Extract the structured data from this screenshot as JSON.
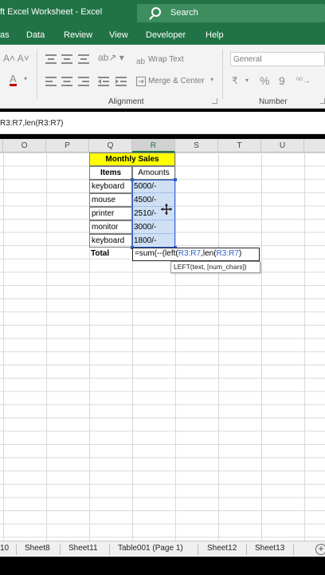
{
  "titlebar": {
    "title": "ft Excel Worksheet  -  Excel",
    "search_placeholder": "Search"
  },
  "menu": [
    "as",
    "Data",
    "Review",
    "View",
    "Developer",
    "Help"
  ],
  "ribbon": {
    "wrap_text": "Wrap Text",
    "merge_center": "Merge & Center",
    "number_format": "General",
    "alignment_label": "Alignment",
    "number_label": "Number",
    "font_size_glyphs": "A˄ A˅",
    "font_color_glyph": "A",
    "percent": "%",
    "comma": "9",
    "currency": "₹"
  },
  "formula_bar": {
    "content": "R3:R7,len(R3:R7)"
  },
  "columns": [
    "O",
    "P",
    "Q",
    "R",
    "S",
    "T",
    "U"
  ],
  "sheet": {
    "header_title": "Monthly Sales",
    "col_items": "Items",
    "col_amounts": "Amounts",
    "rows": [
      {
        "item": "keyboard",
        "amount": "5000/-"
      },
      {
        "item": "mouse",
        "amount": "4500/-"
      },
      {
        "item": "printer",
        "amount": "2510/-"
      },
      {
        "item": "monitor",
        "amount": "3000/-"
      },
      {
        "item": "keyboard",
        "amount": "1800/-"
      }
    ],
    "total_label": "Total",
    "formula_input": "=sum(--(left(R3:R7,len(R3:R7)",
    "tooltip": "LEFT(text, [num_chars])"
  },
  "sheet_tabs": [
    "10",
    "Sheet8",
    "Sheet11",
    "Table001 (Page 1)",
    "Sheet12",
    "Sheet13"
  ],
  "colors": {
    "excel_green": "#217346",
    "header_yellow": "#ffff00",
    "selection_blue": "#cfe0f5",
    "ref_blue": "#2f5fd0"
  }
}
